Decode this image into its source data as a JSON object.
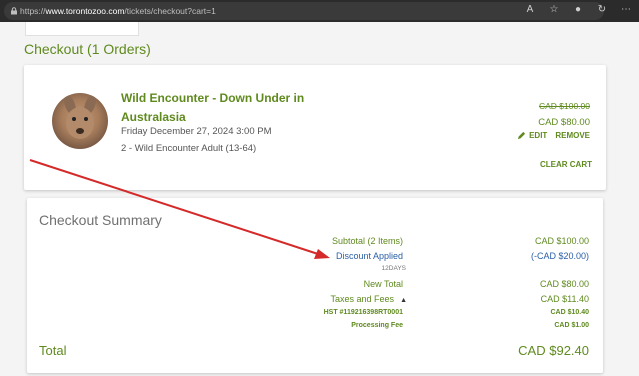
{
  "browser": {
    "url_prefix": "https://",
    "url_host": "www.torontozoo.com",
    "url_path": "/tickets/checkout?cart=1"
  },
  "page": {
    "title": "Checkout (1 Orders)"
  },
  "item": {
    "name": "Wild Encounter - Down Under in Australasia",
    "date": "Friday December 27, 2024 3:00 PM",
    "ticket": "2 - Wild Encounter Adult (13-64)",
    "original_price": "CAD $100.00",
    "price": "CAD $80.00",
    "edit_label": "EDIT",
    "remove_label": "REMOVE",
    "clear_cart_label": "CLEAR CART"
  },
  "summary": {
    "title": "Checkout Summary",
    "subtotal_label": "Subtotal (2 Items)",
    "subtotal_value": "CAD $100.00",
    "discount_label": "Discount Applied",
    "discount_value": "(-CAD $20.00)",
    "discount_code": "12DAYS",
    "new_total_label": "New Total",
    "new_total_value": "CAD $80.00",
    "taxes_label": "Taxes and Fees",
    "taxes_value": "CAD $11.40",
    "hst_label": "HST #119216398RT0001",
    "hst_value": "CAD $10.40",
    "processing_label": "Processing Fee",
    "processing_value": "CAD $1.00",
    "total_label": "Total",
    "total_value": "CAD $92.40"
  },
  "colors": {
    "accent_green": "#5f8a1e",
    "discount_blue": "#2a5ea8",
    "annotation_red": "#d42a2a"
  },
  "icons": [
    "lock-icon",
    "read-aloud-icon",
    "favorite-star-icon",
    "extension-icon",
    "refresh-icon",
    "more-icon",
    "pencil-icon",
    "chevron-up-icon"
  ]
}
